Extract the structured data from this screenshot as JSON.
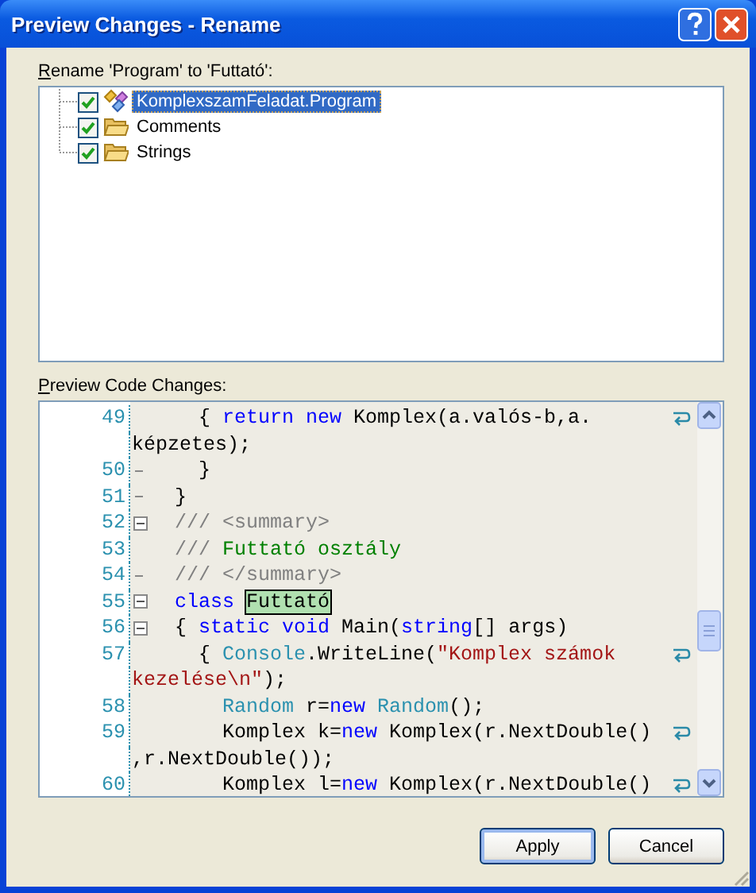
{
  "window": {
    "title": "Preview Changes - Rename"
  },
  "rename_label": "Rename 'Program' to 'Futtató':",
  "tree": [
    {
      "label": "KomplexszamFeladat.Program",
      "checked": true,
      "selected": true,
      "kind": "class"
    },
    {
      "label": "Comments",
      "checked": true,
      "selected": false,
      "kind": "folder"
    },
    {
      "label": "Strings",
      "checked": true,
      "selected": false,
      "kind": "folder"
    }
  ],
  "preview_label": "Preview Code Changes:",
  "code_lines": [
    {
      "number": "49",
      "kind": "plain",
      "parts": [
        {
          "kind": "plain",
          "text": "    { "
        },
        {
          "kind": "keyword",
          "text": "return new"
        },
        {
          "kind": "plain",
          "text": " Komplex(a.valós-b,a."
        }
      ],
      "continuation": [
        {
          "kind": "plain",
          "text": "képzetes);"
        }
      ]
    },
    {
      "number": "50",
      "kind": "fold-end",
      "parts": [
        {
          "kind": "plain",
          "text": "    }"
        }
      ]
    },
    {
      "number": "51",
      "kind": "fold-end",
      "parts": [
        {
          "kind": "plain",
          "text": "  }"
        }
      ]
    },
    {
      "number": "52",
      "kind": "fold-start",
      "parts": [
        {
          "kind": "doc",
          "text": "  /// <summary>"
        }
      ]
    },
    {
      "number": "53",
      "kind": "plain",
      "parts": [
        {
          "kind": "doc",
          "text": "  /// "
        },
        {
          "kind": "comment",
          "text": "Futtató osztály"
        }
      ]
    },
    {
      "number": "54",
      "kind": "fold-end",
      "parts": [
        {
          "kind": "doc",
          "text": "  /// </summary>"
        }
      ]
    },
    {
      "number": "55",
      "kind": "fold-start",
      "parts": [
        {
          "kind": "keyword",
          "text": "  class "
        },
        {
          "kind": "highlight",
          "text": "Futtató"
        }
      ]
    },
    {
      "number": "56",
      "kind": "fold-start",
      "parts": [
        {
          "kind": "plain",
          "text": "  { "
        },
        {
          "kind": "keyword",
          "text": "static void"
        },
        {
          "kind": "plain",
          "text": " Main("
        },
        {
          "kind": "keyword",
          "text": "string"
        },
        {
          "kind": "plain",
          "text": "[] args)"
        }
      ]
    },
    {
      "number": "57",
      "kind": "plain",
      "parts": [
        {
          "kind": "plain",
          "text": "    { "
        },
        {
          "kind": "type",
          "text": "Console"
        },
        {
          "kind": "plain",
          "text": ".WriteLine("
        },
        {
          "kind": "string",
          "text": "\"Komplex számok"
        }
      ],
      "continuation": [
        {
          "kind": "string",
          "text": "kezelése\\n\""
        },
        {
          "kind": "plain",
          "text": ");"
        }
      ]
    },
    {
      "number": "58",
      "kind": "plain",
      "parts": [
        {
          "kind": "type",
          "text": "      Random"
        },
        {
          "kind": "plain",
          "text": " r="
        },
        {
          "kind": "keyword",
          "text": "new"
        },
        {
          "kind": "type",
          "text": " Random"
        },
        {
          "kind": "plain",
          "text": "();"
        }
      ]
    },
    {
      "number": "59",
      "kind": "plain",
      "parts": [
        {
          "kind": "plain",
          "text": "      Komplex k="
        },
        {
          "kind": "keyword",
          "text": "new"
        },
        {
          "kind": "plain",
          "text": " Komplex(r.NextDouble()"
        }
      ],
      "continuation": [
        {
          "kind": "plain",
          "text": ",r.NextDouble());"
        }
      ]
    },
    {
      "number": "60",
      "kind": "plain",
      "parts": [
        {
          "kind": "plain",
          "text": "      Komplex l="
        },
        {
          "kind": "keyword",
          "text": "new"
        },
        {
          "kind": "plain",
          "text": " Komplex(r.NextDouble()"
        }
      ],
      "wrapped": true
    }
  ],
  "buttons": [
    {
      "label": "Apply",
      "default": true
    },
    {
      "label": "Cancel",
      "default": false
    }
  ]
}
